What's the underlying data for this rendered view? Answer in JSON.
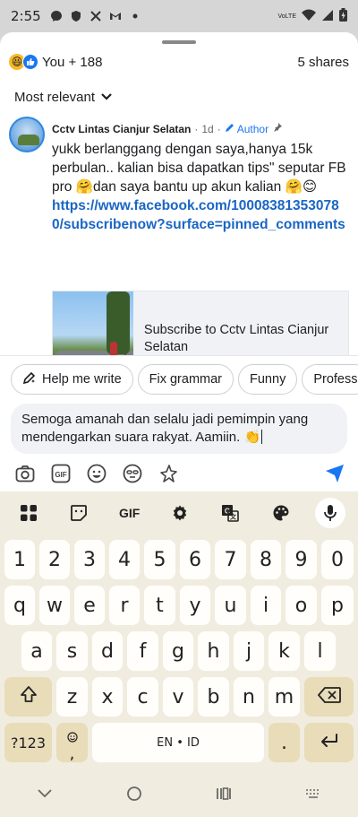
{
  "status_bar": {
    "time": "2:55",
    "network_label": "VoLTE"
  },
  "sheet": {
    "reactions": {
      "emoji": [
        "haha",
        "like"
      ],
      "count_label": "You + 188",
      "shares_label": "5 shares"
    },
    "sort_label": "Most relevant",
    "comment": {
      "author": "Cctv Lintas Cianjur Selatan",
      "time": "1d",
      "author_badge": "Author",
      "text": "yukk berlanggang dengan saya,hanya 15k perbulan.. kalian bisa dapatkan tips\" seputar FB pro 🤗dan saya bantu up akun kalian 🤗😊",
      "link": "https://www.facebook.com/100083813530780/subscribenow?surface=pinned_comments",
      "card_title": "Subscribe to Cctv Lintas Cianjur Selatan"
    }
  },
  "ai_chips": [
    "Help me write",
    "Fix grammar",
    "Funny",
    "Profess"
  ],
  "compose": {
    "text": "Semoga amanah dan selalu jadi pemimpin yang mendengarkan suara rakyat. Aamiin. 👏"
  },
  "keyboard": {
    "toolbar": [
      "apps-icon",
      "sticker-icon",
      "GIF",
      "settings-icon",
      "translate-icon",
      "palette-icon",
      "mic-icon"
    ],
    "numbers": [
      "1",
      "2",
      "3",
      "4",
      "5",
      "6",
      "7",
      "8",
      "9",
      "0"
    ],
    "row1": [
      "q",
      "w",
      "e",
      "r",
      "t",
      "y",
      "u",
      "i",
      "o",
      "p"
    ],
    "row2": [
      "a",
      "s",
      "d",
      "f",
      "g",
      "h",
      "j",
      "k",
      "l"
    ],
    "row3": [
      "z",
      "x",
      "c",
      "v",
      "b",
      "n",
      "m"
    ],
    "symbols_label": "?123",
    "comma": ",",
    "space_label": "EN • ID",
    "period": "."
  },
  "colors": {
    "facebook_blue": "#1877f2",
    "link_blue": "#1a66c4",
    "keyboard_bg": "#f1ece0",
    "modifier_key": "#e8dcb9"
  }
}
